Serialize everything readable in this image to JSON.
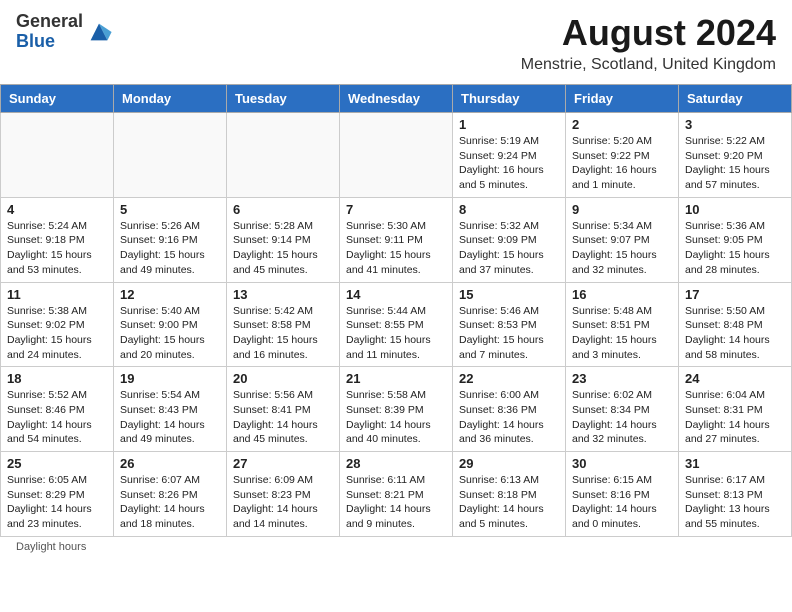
{
  "header": {
    "logo_general": "General",
    "logo_blue": "Blue",
    "month_title": "August 2024",
    "location": "Menstrie, Scotland, United Kingdom"
  },
  "days_of_week": [
    "Sunday",
    "Monday",
    "Tuesday",
    "Wednesday",
    "Thursday",
    "Friday",
    "Saturday"
  ],
  "footer": {
    "note": "Daylight hours"
  },
  "weeks": [
    [
      {
        "day": "",
        "info": ""
      },
      {
        "day": "",
        "info": ""
      },
      {
        "day": "",
        "info": ""
      },
      {
        "day": "",
        "info": ""
      },
      {
        "day": "1",
        "info": "Sunrise: 5:19 AM\nSunset: 9:24 PM\nDaylight: 16 hours\nand 5 minutes."
      },
      {
        "day": "2",
        "info": "Sunrise: 5:20 AM\nSunset: 9:22 PM\nDaylight: 16 hours\nand 1 minute."
      },
      {
        "day": "3",
        "info": "Sunrise: 5:22 AM\nSunset: 9:20 PM\nDaylight: 15 hours\nand 57 minutes."
      }
    ],
    [
      {
        "day": "4",
        "info": "Sunrise: 5:24 AM\nSunset: 9:18 PM\nDaylight: 15 hours\nand 53 minutes."
      },
      {
        "day": "5",
        "info": "Sunrise: 5:26 AM\nSunset: 9:16 PM\nDaylight: 15 hours\nand 49 minutes."
      },
      {
        "day": "6",
        "info": "Sunrise: 5:28 AM\nSunset: 9:14 PM\nDaylight: 15 hours\nand 45 minutes."
      },
      {
        "day": "7",
        "info": "Sunrise: 5:30 AM\nSunset: 9:11 PM\nDaylight: 15 hours\nand 41 minutes."
      },
      {
        "day": "8",
        "info": "Sunrise: 5:32 AM\nSunset: 9:09 PM\nDaylight: 15 hours\nand 37 minutes."
      },
      {
        "day": "9",
        "info": "Sunrise: 5:34 AM\nSunset: 9:07 PM\nDaylight: 15 hours\nand 32 minutes."
      },
      {
        "day": "10",
        "info": "Sunrise: 5:36 AM\nSunset: 9:05 PM\nDaylight: 15 hours\nand 28 minutes."
      }
    ],
    [
      {
        "day": "11",
        "info": "Sunrise: 5:38 AM\nSunset: 9:02 PM\nDaylight: 15 hours\nand 24 minutes."
      },
      {
        "day": "12",
        "info": "Sunrise: 5:40 AM\nSunset: 9:00 PM\nDaylight: 15 hours\nand 20 minutes."
      },
      {
        "day": "13",
        "info": "Sunrise: 5:42 AM\nSunset: 8:58 PM\nDaylight: 15 hours\nand 16 minutes."
      },
      {
        "day": "14",
        "info": "Sunrise: 5:44 AM\nSunset: 8:55 PM\nDaylight: 15 hours\nand 11 minutes."
      },
      {
        "day": "15",
        "info": "Sunrise: 5:46 AM\nSunset: 8:53 PM\nDaylight: 15 hours\nand 7 minutes."
      },
      {
        "day": "16",
        "info": "Sunrise: 5:48 AM\nSunset: 8:51 PM\nDaylight: 15 hours\nand 3 minutes."
      },
      {
        "day": "17",
        "info": "Sunrise: 5:50 AM\nSunset: 8:48 PM\nDaylight: 14 hours\nand 58 minutes."
      }
    ],
    [
      {
        "day": "18",
        "info": "Sunrise: 5:52 AM\nSunset: 8:46 PM\nDaylight: 14 hours\nand 54 minutes."
      },
      {
        "day": "19",
        "info": "Sunrise: 5:54 AM\nSunset: 8:43 PM\nDaylight: 14 hours\nand 49 minutes."
      },
      {
        "day": "20",
        "info": "Sunrise: 5:56 AM\nSunset: 8:41 PM\nDaylight: 14 hours\nand 45 minutes."
      },
      {
        "day": "21",
        "info": "Sunrise: 5:58 AM\nSunset: 8:39 PM\nDaylight: 14 hours\nand 40 minutes."
      },
      {
        "day": "22",
        "info": "Sunrise: 6:00 AM\nSunset: 8:36 PM\nDaylight: 14 hours\nand 36 minutes."
      },
      {
        "day": "23",
        "info": "Sunrise: 6:02 AM\nSunset: 8:34 PM\nDaylight: 14 hours\nand 32 minutes."
      },
      {
        "day": "24",
        "info": "Sunrise: 6:04 AM\nSunset: 8:31 PM\nDaylight: 14 hours\nand 27 minutes."
      }
    ],
    [
      {
        "day": "25",
        "info": "Sunrise: 6:05 AM\nSunset: 8:29 PM\nDaylight: 14 hours\nand 23 minutes."
      },
      {
        "day": "26",
        "info": "Sunrise: 6:07 AM\nSunset: 8:26 PM\nDaylight: 14 hours\nand 18 minutes."
      },
      {
        "day": "27",
        "info": "Sunrise: 6:09 AM\nSunset: 8:23 PM\nDaylight: 14 hours\nand 14 minutes."
      },
      {
        "day": "28",
        "info": "Sunrise: 6:11 AM\nSunset: 8:21 PM\nDaylight: 14 hours\nand 9 minutes."
      },
      {
        "day": "29",
        "info": "Sunrise: 6:13 AM\nSunset: 8:18 PM\nDaylight: 14 hours\nand 5 minutes."
      },
      {
        "day": "30",
        "info": "Sunrise: 6:15 AM\nSunset: 8:16 PM\nDaylight: 14 hours\nand 0 minutes."
      },
      {
        "day": "31",
        "info": "Sunrise: 6:17 AM\nSunset: 8:13 PM\nDaylight: 13 hours\nand 55 minutes."
      }
    ]
  ]
}
